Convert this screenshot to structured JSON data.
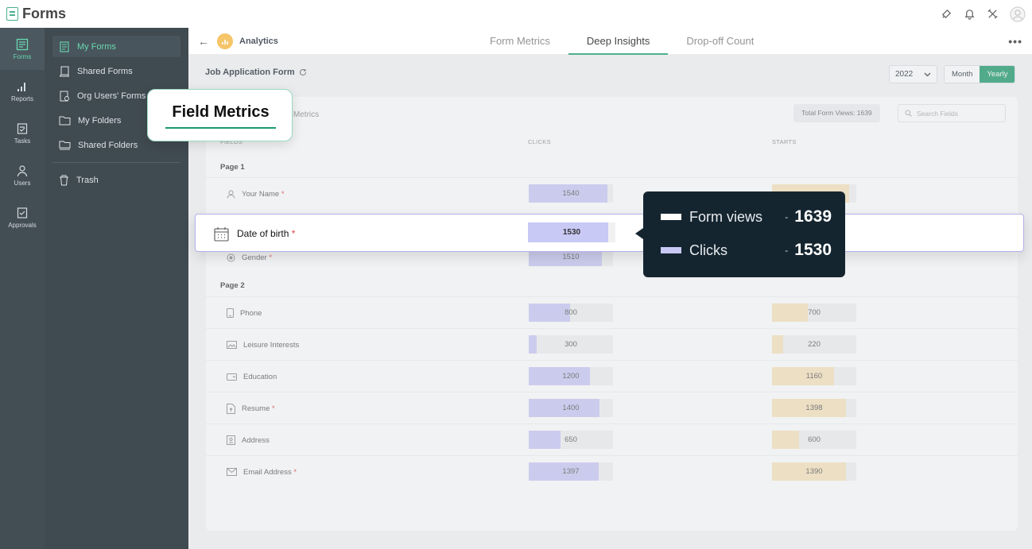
{
  "app": {
    "name": "Forms"
  },
  "rail": [
    {
      "label": "Forms",
      "icon": "forms-icon",
      "active": true
    },
    {
      "label": "Reports",
      "icon": "reports-icon"
    },
    {
      "label": "Tasks",
      "icon": "tasks-icon"
    },
    {
      "label": "Users",
      "icon": "users-icon"
    },
    {
      "label": "Approvals",
      "icon": "approvals-icon"
    }
  ],
  "sidebar": {
    "items": [
      {
        "label": "My Forms",
        "icon": "form-icon"
      },
      {
        "label": "Shared Forms",
        "icon": "shared-forms-icon"
      },
      {
        "label": "Org Users' Forms",
        "icon": "org-forms-icon"
      },
      {
        "label": "My Folders",
        "icon": "folder-icon"
      },
      {
        "label": "Shared Folders",
        "icon": "shared-folder-icon"
      }
    ],
    "trash": {
      "label": "Trash",
      "icon": "trash-icon"
    }
  },
  "header": {
    "title": "Analytics",
    "tabs": [
      "Form Metrics",
      "Deep Insights",
      "Drop-off Count"
    ],
    "active_tab": "Deep Insights"
  },
  "toolbar": {
    "form_title": "Job Application Form",
    "year": "2022",
    "month_label": "Month",
    "yearly_label": "Yearly"
  },
  "card": {
    "title": "ge Metrics",
    "total_views": "Total Form Views:  1639",
    "search_placeholder": "Search Fields",
    "columns": [
      "FIELDS",
      "CLICKS",
      "STARTS"
    ]
  },
  "pages": [
    {
      "label": "Page 1",
      "rows": [
        {
          "field": "Your Name",
          "required": true,
          "icon": "user-icon",
          "clicks": 1540,
          "starts": null
        },
        {
          "field": "Gender",
          "required": true,
          "icon": "radio-icon",
          "clicks": 1510,
          "starts": null
        }
      ]
    },
    {
      "label": "Page 2",
      "rows": [
        {
          "field": "Phone",
          "required": false,
          "icon": "phone-icon",
          "clicks": 800,
          "starts": 700
        },
        {
          "field": "Leisure Interests",
          "required": false,
          "icon": "image-icon",
          "clicks": 300,
          "starts": 220
        },
        {
          "field": "Education",
          "required": false,
          "icon": "dropdown-icon",
          "clicks": 1200,
          "starts": 1160
        },
        {
          "field": "Resume",
          "required": true,
          "icon": "file-upload-icon",
          "clicks": 1400,
          "starts": 1398
        },
        {
          "field": "Address",
          "required": false,
          "icon": "address-icon",
          "clicks": 650,
          "starts": 600
        },
        {
          "field": "Email Address",
          "required": true,
          "icon": "email-icon",
          "clicks": 1397,
          "starts": 1390
        }
      ]
    }
  ],
  "highlight": {
    "field": "Date of birth",
    "required_mark": "*",
    "clicks": "1530"
  },
  "callout": {
    "label": "Field Metrics"
  },
  "tooltip": {
    "rows": [
      {
        "label": "Form views",
        "dash": "-",
        "value": "1639",
        "color": "#ffffff"
      },
      {
        "label": "Clicks",
        "dash": "-",
        "value": "1530",
        "color": "#c9c9f6"
      }
    ]
  },
  "colors": {
    "accent": "#1a9a6b",
    "clicks_bar": "#c9c9f6",
    "starts_bar": "#f8e4bd",
    "required": "#e04040",
    "sidebar_bg": "#0b1820"
  }
}
